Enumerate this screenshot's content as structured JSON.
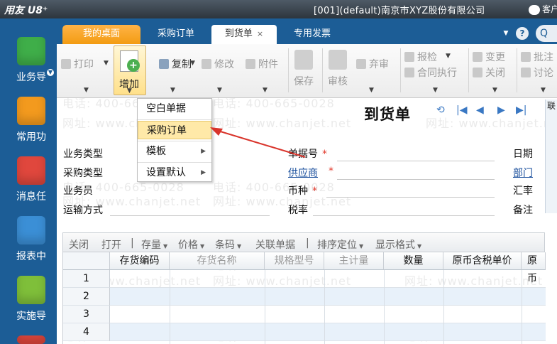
{
  "app": {
    "logo": "用友 U8⁺",
    "company": "[001](default)南京市XYZ股份有限公司",
    "service": "客户"
  },
  "sidebar": {
    "items": [
      {
        "label": "业务导",
        "color": "#3fae49"
      },
      {
        "label": "常用功",
        "color": "#f39a1e"
      },
      {
        "label": "消息任",
        "color": "#e0473d"
      },
      {
        "label": "报表中",
        "color": "#3b8fd6"
      },
      {
        "label": "实施导",
        "color": "#7fbf3a"
      }
    ]
  },
  "tabs": {
    "desk": "我的桌面",
    "purchase_order": "采购订单",
    "arrival": "到货单",
    "invoice": "专用发票",
    "close": "×",
    "more": "▼",
    "help": "?",
    "search": "Q"
  },
  "toolbar": {
    "print": "打印",
    "add": "增加",
    "copy": "复制",
    "edit": "修改",
    "attach": "附件",
    "save": "保存",
    "review": "审核",
    "abandon": "弃审",
    "report": "报检",
    "contract": "合同执行",
    "change": "变更",
    "close": "关闭",
    "batch": "批注",
    "discuss": "讨论"
  },
  "dropdown_menu": {
    "items": [
      "空白单据",
      "采购订单",
      "模板",
      "设置默认"
    ],
    "highlighted": "采购订单"
  },
  "document": {
    "title": "到货单",
    "nav": [
      "⟲",
      "|◀",
      "◀",
      "▶",
      "▶|"
    ],
    "right_tab": "联"
  },
  "form": {
    "business_type": "业务类型",
    "purchase_type": "采购类型",
    "salesperson": "业务员",
    "transport": "运输方式",
    "doc_no": "单据号",
    "supplier": "供应商",
    "currency": "币种",
    "tax_rate": "税率",
    "date": "日期",
    "dept": "部门",
    "exchange": "汇率",
    "remark": "备注",
    "required_mark": "*"
  },
  "grid_toolbar": {
    "close": "关闭",
    "open": "打开",
    "stock": "存量",
    "price": "价格",
    "barcode": "条码",
    "related": "关联单据",
    "sort": "排序定位",
    "display": "显示格式"
  },
  "grid": {
    "columns": [
      "存货编码",
      "存货名称",
      "规格型号",
      "主计量",
      "数量",
      "原币含税单价",
      "原币"
    ],
    "rows": [
      "1",
      "2",
      "3",
      "4"
    ]
  },
  "watermark": {
    "phone": "电话: 400-665-0028",
    "site": "网址: www.chanjet.net"
  }
}
